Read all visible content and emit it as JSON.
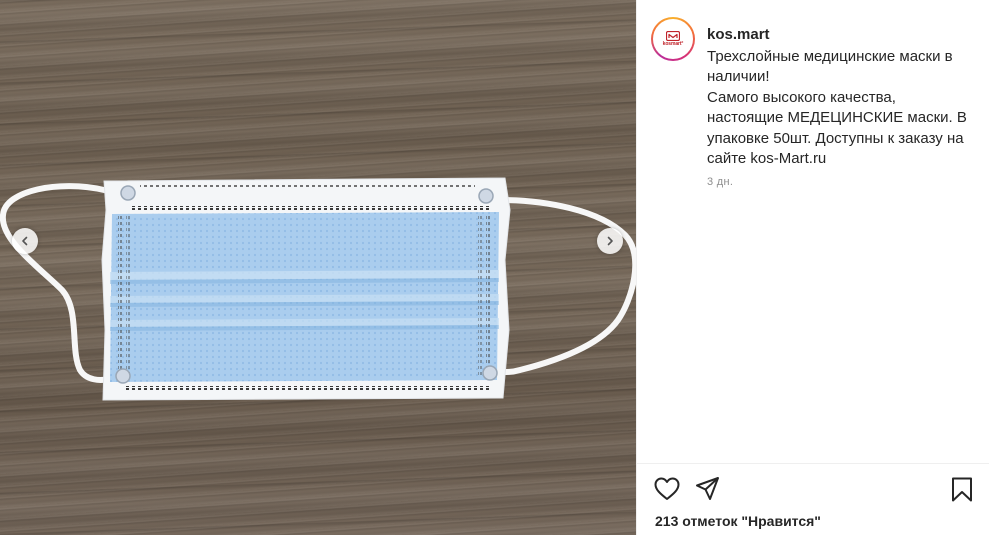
{
  "post": {
    "username": "kos.mart",
    "avatar_text": "kosmart°",
    "caption_lines": [
      "Трехслойные медицинские маски в",
      "наличии!",
      "Самого высокого качества,",
      "настоящие МЕДЕЦИНСКИЕ маски. В",
      "упаковке 50шт. Доступны к заказу на",
      "сайте kos-Mart.ru"
    ],
    "timestamp": "3 дн.",
    "likes": "213 отметок \"Нравится\""
  },
  "icons": {
    "prev": "chevron-left-icon",
    "next": "chevron-right-icon",
    "like": "heart-icon",
    "share": "paper-plane-icon",
    "save": "bookmark-icon"
  },
  "colors": {
    "mask_blue": "#a9cfee",
    "mask_border": "#f4f6f8",
    "wood": "#74665a",
    "brand_red": "#c0242b",
    "meta_gray": "#8e8e8e"
  }
}
